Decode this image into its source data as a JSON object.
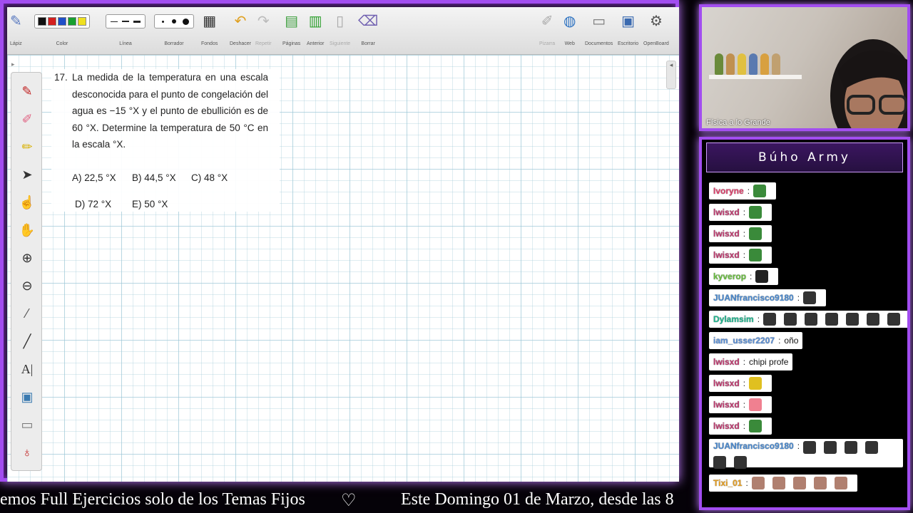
{
  "toolbar": {
    "lapiz": "Lápiz",
    "color": "Color",
    "linea": "Línea",
    "borrador": "Borrador",
    "fondos": "Fondos",
    "deshacer": "Deshacer",
    "repetir": "Repetir",
    "paginas": "Páginas",
    "anterior": "Anterior",
    "siguiente": "Siguiente",
    "borrar": "Borrar",
    "pizarra": "Pizarra",
    "web": "Web",
    "documentos": "Documentos",
    "escritorio": "Escritorio",
    "openboard": "OpenBoard",
    "colors": [
      "#111111",
      "#d42020",
      "#2050c8",
      "#18a030",
      "#f0e020"
    ]
  },
  "problem": {
    "number": "17.",
    "statement": "La medida de la temperatura en una escala desconocida para el punto de congelación del agua es −15 °X y el punto de ebullición es de 60 °X. Determine la temperatura de 50 °C en la escala °X.",
    "options": {
      "a": "A) 22,5 °X",
      "b": "B) 44,5 °X",
      "c": "C) 48 °X",
      "d": "D) 72 °X",
      "e": "E) 50 °X"
    }
  },
  "webcam": {
    "label": "Física a lo Grande"
  },
  "chat": {
    "title": "Búho Army",
    "messages": [
      {
        "user": "Ivoryne",
        "color": "#e0426e",
        "text": "",
        "emotes": 1,
        "emote_color": "#3a8a3a"
      },
      {
        "user": "lwisxd",
        "color": "#c03a70",
        "text": "",
        "emotes": 1,
        "emote_color": "#3a8a3a"
      },
      {
        "user": "lwisxd",
        "color": "#c03a70",
        "text": "",
        "emotes": 1,
        "emote_color": "#3a8a3a"
      },
      {
        "user": "lwisxd",
        "color": "#c03a70",
        "text": "",
        "emotes": 1,
        "emote_color": "#3a8a3a"
      },
      {
        "user": "kyverop",
        "color": "#6ac040",
        "text": "",
        "emotes": 1,
        "emote_color": "#222222"
      },
      {
        "user": "JUANfrancisco9180",
        "color": "#4a8ad0",
        "text": "",
        "emotes": 1,
        "emote_color": "#333333"
      },
      {
        "user": "Dylamsim",
        "color": "#20b890",
        "text": "",
        "emotes": 7,
        "emote_color": "#333333"
      },
      {
        "user": "iam_usser2207",
        "color": "#5a90d8",
        "text": "oño",
        "emotes": 0,
        "emote_color": "#333333"
      },
      {
        "user": "lwisxd",
        "color": "#c03a70",
        "text": "chipi profe",
        "emotes": 0,
        "emote_color": "#333333"
      },
      {
        "user": "lwisxd",
        "color": "#c03a70",
        "text": "",
        "emotes": 1,
        "emote_color": "#e0c020"
      },
      {
        "user": "lwisxd",
        "color": "#c03a70",
        "text": "",
        "emotes": 1,
        "emote_color": "#f08090"
      },
      {
        "user": "lwisxd",
        "color": "#c03a70",
        "text": "",
        "emotes": 1,
        "emote_color": "#3a8a3a"
      },
      {
        "user": "JUANfrancisco9180",
        "color": "#4a8ad0",
        "text": "",
        "emotes": 6,
        "emote_color": "#333333"
      },
      {
        "user": "Tixi_01",
        "color": "#e8a020",
        "text": "",
        "emotes": 5,
        "emote_color": "#b08070"
      }
    ]
  },
  "ticker": {
    "left": "emos Full Ejercicios solo de los Temas Fijos",
    "heart": "♡",
    "right": "Este Domingo 01 de Marzo, desde las 8"
  }
}
